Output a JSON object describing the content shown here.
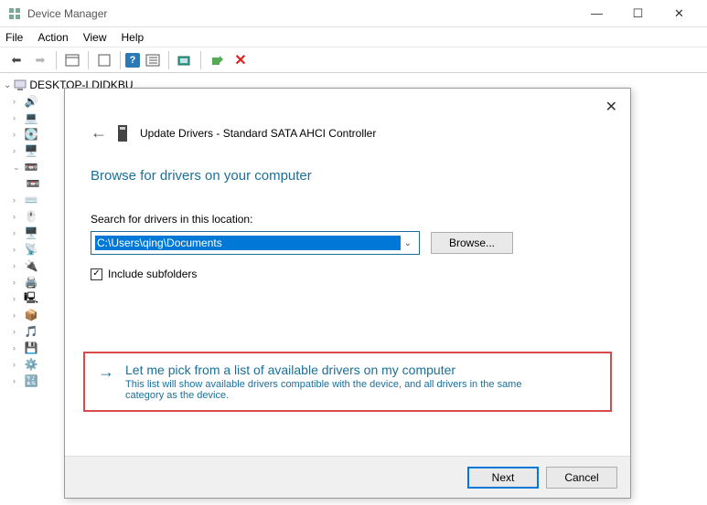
{
  "window": {
    "title": "Device Manager"
  },
  "menu": {
    "file": "File",
    "action": "Action",
    "view": "View",
    "help": "Help"
  },
  "tree": {
    "root": "DESKTOP-LDIDKBU"
  },
  "dialog": {
    "header": "Update Drivers - Standard SATA AHCI Controller",
    "title": "Browse for drivers on your computer",
    "search_label": "Search for drivers in this location:",
    "path": "C:\\Users\\qing\\Documents",
    "browse": "Browse...",
    "include_subfolders": "Include subfolders",
    "pick_title": "Let me pick from a list of available drivers on my computer",
    "pick_desc": "This list will show available drivers compatible with the device, and all drivers in the same category as the device.",
    "next": "Next",
    "cancel": "Cancel"
  }
}
